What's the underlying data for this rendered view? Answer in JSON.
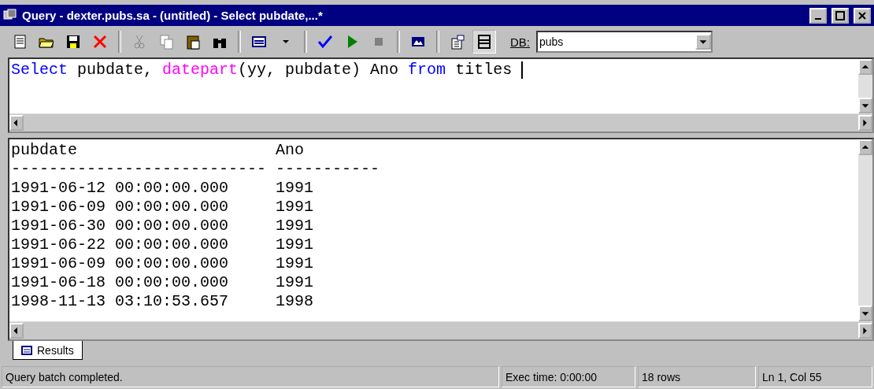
{
  "window": {
    "title": "Query - dexter.pubs.sa - (untitled) - Select pubdate,...*"
  },
  "toolbar": {
    "db_label": "DB:",
    "db_value": "pubs"
  },
  "editor": {
    "tokens": [
      {
        "kind": "keyword",
        "text": "Select"
      },
      {
        "kind": "text",
        "text": " pubdate, "
      },
      {
        "kind": "function",
        "text": "datepart"
      },
      {
        "kind": "text",
        "text": "(yy, pubdate) Ano "
      },
      {
        "kind": "keyword",
        "text": "from"
      },
      {
        "kind": "text",
        "text": " titles "
      }
    ]
  },
  "results": {
    "columns": [
      {
        "heading": "pubdate",
        "rule": "---------------------------"
      },
      {
        "heading": "Ano",
        "rule": "-----------"
      }
    ],
    "rows": [
      [
        "1991-06-12 00:00:00.000",
        "1991"
      ],
      [
        "1991-06-09 00:00:00.000",
        "1991"
      ],
      [
        "1991-06-30 00:00:00.000",
        "1991"
      ],
      [
        "1991-06-22 00:00:00.000",
        "1991"
      ],
      [
        "1991-06-09 00:00:00.000",
        "1991"
      ],
      [
        "1991-06-18 00:00:00.000",
        "1991"
      ],
      [
        "1998-11-13 03:10:53.657",
        "1998"
      ]
    ]
  },
  "tabs": [
    {
      "label": "Results",
      "selected": true
    }
  ],
  "status_bar": [
    "Query batch completed.",
    "Exec time: 0:00:00",
    "18 rows",
    "Ln 1, Col 55"
  ]
}
